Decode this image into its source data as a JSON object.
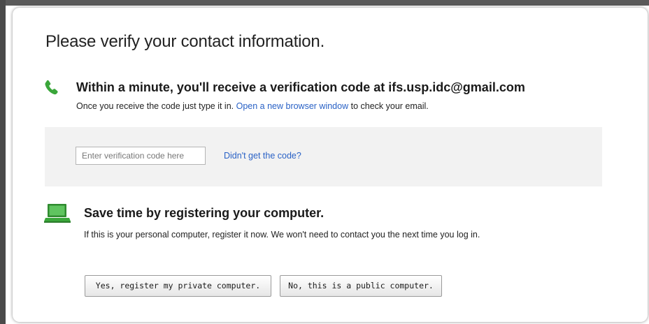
{
  "page": {
    "title": "Please verify your contact information."
  },
  "verification": {
    "heading": "Within a minute, you'll receive a verification code at ifs.usp.idc@gmail.com",
    "description_prefix": "Once you receive the code just type it in.",
    "link_text": "Open a new browser window",
    "description_suffix": "to check your email.",
    "input_placeholder": "Enter verification code here",
    "input_value": "",
    "resend_link": "Didn't get the code?"
  },
  "register": {
    "heading": "Save time by registering your computer.",
    "description": "If this is your personal computer, register it now. We won't need to contact you the next time you log in.",
    "yes_button": "Yes, register my private computer.",
    "no_button": "No, this is a public computer."
  },
  "icons": {
    "phone": "phone-icon",
    "laptop": "laptop-icon"
  },
  "colors": {
    "link": "#2a62c6",
    "icon_green": "#3aa63a",
    "panel_bg": "#f2f2f2"
  }
}
